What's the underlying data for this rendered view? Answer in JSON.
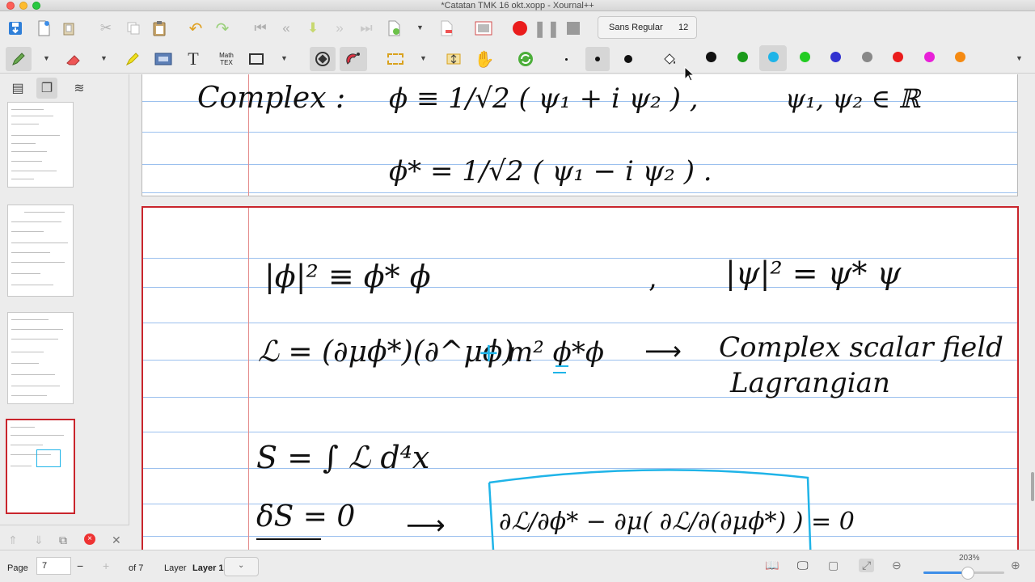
{
  "window": {
    "title": "*Catatan TMK 16 okt.xopp - Xournal++"
  },
  "toolbar": {
    "font_name": "Sans Regular",
    "font_size": "12",
    "math_tex_line1": "Math",
    "math_tex_line2": "TEX",
    "text_tool": "T"
  },
  "colors": {
    "accent_record": "#ea1c1c",
    "page_border_current": "#c9252c",
    "palette": [
      "#111111",
      "#1a9a1a",
      "#1fb4e8",
      "#22cc22",
      "#3232d0",
      "#888888",
      "#ea1c1c",
      "#e820d8",
      "#f58a12"
    ],
    "selected_color": "#1fb4e8"
  },
  "notes": {
    "page6_line1_left": "Complex :",
    "page6_line1_eq": "ϕ ≡ 1/√2 ( ψ₁ + i ψ₂ )   ,",
    "page6_line1_right": "ψ₁, ψ₂ ∈ ℝ",
    "page6_line2": "ϕ* = 1/√2 ( ψ₁ − i ψ₂ ) .",
    "page7_line1_left": "|ϕ|² ≡ ϕ* ϕ",
    "page7_line1_comma": ",",
    "page7_line1_right": "|ψ|² = ψ* ψ",
    "page7_line2_left": "ℒ = (∂μϕ*)(∂^μϕ)",
    "page7_line2_plus": "+",
    "page7_line2_mass": "m² ϕ*ϕ",
    "page7_line2_arrow": "⟶",
    "page7_line2_right1": "Complex scalar field",
    "page7_line2_right2": "Lagrangian",
    "page7_line3": "S = ∫ ℒ d⁴x",
    "page7_line4_left": "δS = 0",
    "page7_line4_arrow": "⟶",
    "page7_line4_box": "∂ℒ/∂ϕ* − ∂μ( ∂ℒ/∂(∂μϕ*) ) = 0"
  },
  "statusbar": {
    "page_label": "Page",
    "page_value": "7",
    "minus": "−",
    "plus": "+",
    "of_pages": "of 7",
    "layer_label": "Layer",
    "layer_value": "Layer 1",
    "zoom": "203%",
    "zoom_fraction": 0.58
  }
}
